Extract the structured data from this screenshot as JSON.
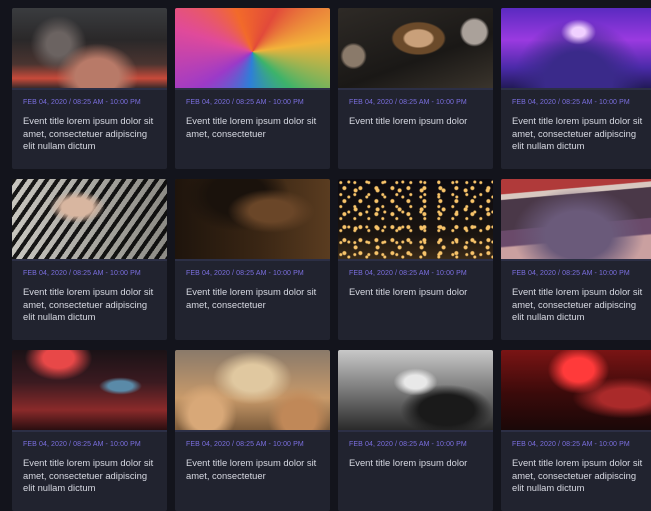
{
  "events": [
    {
      "date": "FEB 04, 2020 / 08:25 AM - 10:00 PM",
      "title": "Event title lorem ipsum dolor sit amet, consectetuer adipiscing elit nullam dictum"
    },
    {
      "date": "FEB 04, 2020 / 08:25 AM - 10:00 PM",
      "title": "Event title lorem ipsum dolor sit amet, consectetuer"
    },
    {
      "date": "FEB 04, 2020 / 08:25 AM - 10:00 PM",
      "title": "Event title lorem ipsum dolor"
    },
    {
      "date": "FEB 04, 2020 / 08:25 AM - 10:00 PM",
      "title": "Event title lorem ipsum dolor sit amet, consectetuer adipiscing elit nullam dictum"
    },
    {
      "date": "FEB 04, 2020 / 08:25 AM - 10:00 PM",
      "title": "Event title lorem ipsum dolor sit amet, consectetuer adipiscing elit nullam dictum"
    },
    {
      "date": "FEB 04, 2020 / 08:25 AM - 10:00 PM",
      "title": "Event title lorem ipsum dolor sit amet, consectetuer"
    },
    {
      "date": "FEB 04, 2020 / 08:25 AM - 10:00 PM",
      "title": "Event title lorem ipsum dolor"
    },
    {
      "date": "FEB 04, 2020 / 08:25 AM - 10:00 PM",
      "title": "Event title lorem ipsum dolor sit amet, consectetuer adipiscing elit nullam dictum"
    },
    {
      "date": "FEB 04, 2020 / 08:25 AM - 10:00 PM",
      "title": "Event title lorem ipsum dolor sit amet, consectetuer adipiscing elit nullam dictum"
    },
    {
      "date": "FEB 04, 2020 / 08:25 AM - 10:00 PM",
      "title": "Event title lorem ipsum dolor sit amet, consectetuer"
    },
    {
      "date": "FEB 04, 2020 / 08:25 AM - 10:00 PM",
      "title": "Event title lorem ipsum dolor"
    },
    {
      "date": "FEB 04, 2020 / 08:25 AM - 10:00 PM",
      "title": "Event title lorem ipsum dolor sit amet, consectetuer adipiscing elit nullam dictum"
    }
  ],
  "colors": {
    "background": "#13141c",
    "card": "#21232f",
    "date_accent": "#7b6fe0",
    "title_text": "#d7d9e2"
  }
}
